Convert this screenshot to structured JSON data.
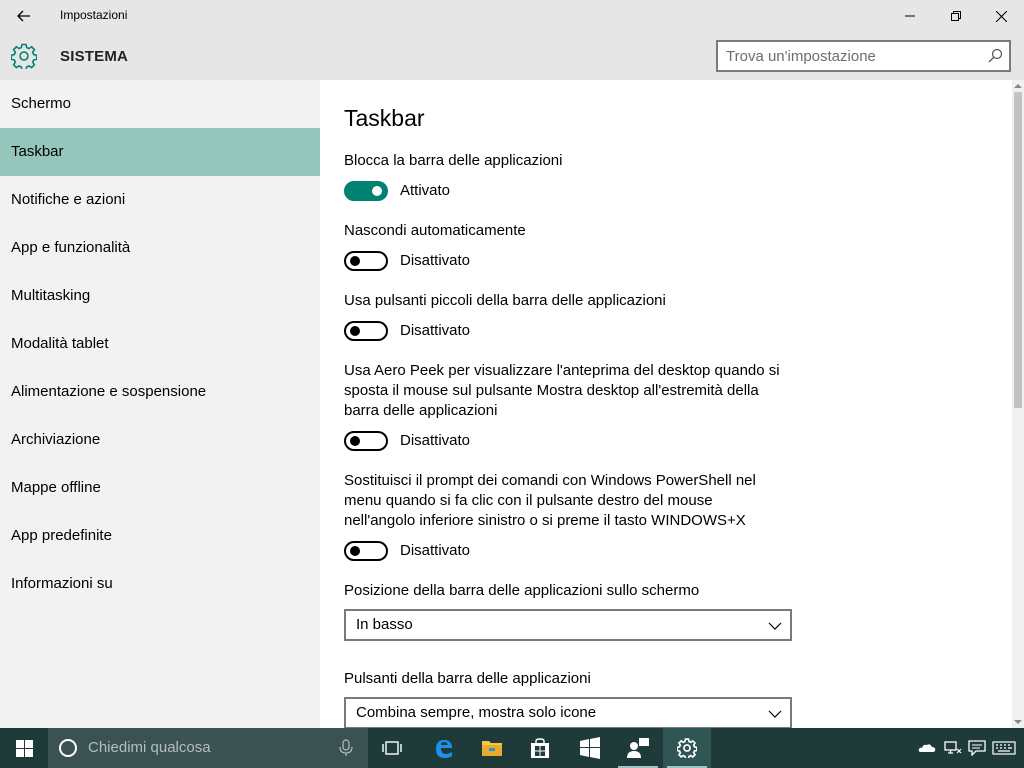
{
  "window": {
    "title": "Impostazioni",
    "section": "SISTEMA"
  },
  "search": {
    "placeholder": "Trova un'impostazione"
  },
  "sidebar": {
    "items": [
      {
        "label": "Schermo"
      },
      {
        "label": "Taskbar",
        "active": true
      },
      {
        "label": "Notifiche e azioni"
      },
      {
        "label": "App e funzionalità"
      },
      {
        "label": "Multitasking"
      },
      {
        "label": "Modalità tablet"
      },
      {
        "label": "Alimentazione e sospensione"
      },
      {
        "label": "Archiviazione"
      },
      {
        "label": "Mappe offline"
      },
      {
        "label": "App predefinite"
      },
      {
        "label": "Informazioni su"
      }
    ]
  },
  "main": {
    "title": "Taskbar",
    "settings": [
      {
        "label": "Blocca la barra delle applicazioni",
        "state": "Attivato",
        "on": true
      },
      {
        "label": "Nascondi automaticamente",
        "state": "Disattivato",
        "on": false
      },
      {
        "label": "Usa pulsanti piccoli della barra delle applicazioni",
        "state": "Disattivato",
        "on": false
      },
      {
        "label_lines": [
          "Usa Aero Peek per visualizzare l'anteprima del desktop quando si",
          "sposta il mouse sul pulsante Mostra desktop all'estremità della",
          "barra delle applicazioni"
        ],
        "state": "Disattivato",
        "on": false
      },
      {
        "label_lines": [
          "Sostituisci il prompt dei comandi con Windows PowerShell nel",
          "menu quando si fa clic con il pulsante destro del mouse",
          "nell'angolo inferiore sinistro o si preme il tasto WINDOWS+X"
        ],
        "state": "Disattivato",
        "on": false
      }
    ],
    "position_label": "Posizione della barra delle applicazioni sullo schermo",
    "position_value": "In basso",
    "buttons_label": "Pulsanti della barra delle applicazioni",
    "buttons_value": "Combina sempre, mostra solo icone"
  },
  "taskbar": {
    "search_placeholder": "Chiedimi qualcosa",
    "colors": {
      "background": "#1e3b3a",
      "accent": "#008272",
      "nav_active": "#95c6bc"
    }
  }
}
